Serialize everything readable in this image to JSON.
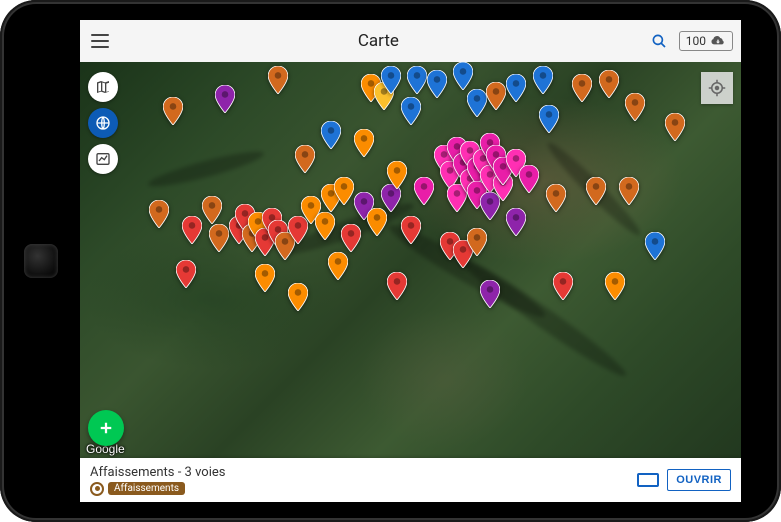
{
  "appbar": {
    "title": "Carte",
    "cloud_count": "100"
  },
  "map": {
    "attribution": "Google"
  },
  "bottom_sheet": {
    "title": "Affaissements - 3 voies",
    "tag_label": "Affaissements",
    "open_label": "OUVRIR"
  },
  "colors": {
    "red": "#e53935",
    "orange": "#fb8c00",
    "darkorange": "#d2691e",
    "magenta": "#e91ea8",
    "pink": "#ff2fb3",
    "purple": "#8e24aa",
    "blue": "#1e73d6",
    "yellow": "#fbc02d"
  },
  "markers": [
    {
      "x": 14,
      "y": 16,
      "c": "darkorange"
    },
    {
      "x": 22,
      "y": 13,
      "c": "purple"
    },
    {
      "x": 30,
      "y": 8,
      "c": "darkorange"
    },
    {
      "x": 34,
      "y": 28,
      "c": "darkorange"
    },
    {
      "x": 38,
      "y": 22,
      "c": "blue"
    },
    {
      "x": 43,
      "y": 24,
      "c": "orange"
    },
    {
      "x": 44,
      "y": 10,
      "c": "orange"
    },
    {
      "x": 46,
      "y": 12,
      "c": "yellow"
    },
    {
      "x": 47,
      "y": 8,
      "c": "blue"
    },
    {
      "x": 50,
      "y": 16,
      "c": "blue"
    },
    {
      "x": 51,
      "y": 8,
      "c": "blue"
    },
    {
      "x": 54,
      "y": 9,
      "c": "blue"
    },
    {
      "x": 58,
      "y": 7,
      "c": "blue"
    },
    {
      "x": 60,
      "y": 14,
      "c": "blue"
    },
    {
      "x": 63,
      "y": 12,
      "c": "darkorange"
    },
    {
      "x": 66,
      "y": 10,
      "c": "blue"
    },
    {
      "x": 70,
      "y": 8,
      "c": "blue"
    },
    {
      "x": 71,
      "y": 18,
      "c": "blue"
    },
    {
      "x": 76,
      "y": 10,
      "c": "darkorange"
    },
    {
      "x": 80,
      "y": 9,
      "c": "darkorange"
    },
    {
      "x": 84,
      "y": 15,
      "c": "darkorange"
    },
    {
      "x": 90,
      "y": 20,
      "c": "darkorange"
    },
    {
      "x": 12,
      "y": 42,
      "c": "darkorange"
    },
    {
      "x": 17,
      "y": 46,
      "c": "red"
    },
    {
      "x": 20,
      "y": 41,
      "c": "darkorange"
    },
    {
      "x": 21,
      "y": 48,
      "c": "darkorange"
    },
    {
      "x": 24,
      "y": 46,
      "c": "red"
    },
    {
      "x": 25,
      "y": 43,
      "c": "red"
    },
    {
      "x": 26,
      "y": 48,
      "c": "darkorange"
    },
    {
      "x": 27,
      "y": 45,
      "c": "orange"
    },
    {
      "x": 28,
      "y": 49,
      "c": "red"
    },
    {
      "x": 29,
      "y": 44,
      "c": "red"
    },
    {
      "x": 30,
      "y": 47,
      "c": "red"
    },
    {
      "x": 31,
      "y": 50,
      "c": "darkorange"
    },
    {
      "x": 33,
      "y": 46,
      "c": "red"
    },
    {
      "x": 35,
      "y": 41,
      "c": "orange"
    },
    {
      "x": 37,
      "y": 45,
      "c": "orange"
    },
    {
      "x": 38,
      "y": 38,
      "c": "orange"
    },
    {
      "x": 40,
      "y": 36,
      "c": "orange"
    },
    {
      "x": 41,
      "y": 48,
      "c": "red"
    },
    {
      "x": 43,
      "y": 40,
      "c": "purple"
    },
    {
      "x": 45,
      "y": 44,
      "c": "orange"
    },
    {
      "x": 47,
      "y": 38,
      "c": "purple"
    },
    {
      "x": 48,
      "y": 32,
      "c": "orange"
    },
    {
      "x": 50,
      "y": 46,
      "c": "red"
    },
    {
      "x": 52,
      "y": 36,
      "c": "magenta"
    },
    {
      "x": 55,
      "y": 28,
      "c": "pink"
    },
    {
      "x": 56,
      "y": 32,
      "c": "pink"
    },
    {
      "x": 57,
      "y": 26,
      "c": "magenta"
    },
    {
      "x": 57,
      "y": 38,
      "c": "pink"
    },
    {
      "x": 58,
      "y": 30,
      "c": "magenta"
    },
    {
      "x": 59,
      "y": 34,
      "c": "pink"
    },
    {
      "x": 59,
      "y": 27,
      "c": "pink"
    },
    {
      "x": 60,
      "y": 31,
      "c": "magenta"
    },
    {
      "x": 60,
      "y": 37,
      "c": "magenta"
    },
    {
      "x": 61,
      "y": 29,
      "c": "pink"
    },
    {
      "x": 62,
      "y": 25,
      "c": "magenta"
    },
    {
      "x": 62,
      "y": 33,
      "c": "pink"
    },
    {
      "x": 62,
      "y": 40,
      "c": "purple"
    },
    {
      "x": 63,
      "y": 28,
      "c": "magenta"
    },
    {
      "x": 64,
      "y": 35,
      "c": "pink"
    },
    {
      "x": 64,
      "y": 31,
      "c": "magenta"
    },
    {
      "x": 66,
      "y": 29,
      "c": "pink"
    },
    {
      "x": 68,
      "y": 33,
      "c": "magenta"
    },
    {
      "x": 66,
      "y": 44,
      "c": "purple"
    },
    {
      "x": 56,
      "y": 50,
      "c": "red"
    },
    {
      "x": 58,
      "y": 52,
      "c": "red"
    },
    {
      "x": 60,
      "y": 49,
      "c": "darkorange"
    },
    {
      "x": 72,
      "y": 38,
      "c": "darkorange"
    },
    {
      "x": 78,
      "y": 36,
      "c": "darkorange"
    },
    {
      "x": 83,
      "y": 36,
      "c": "darkorange"
    },
    {
      "x": 87,
      "y": 50,
      "c": "blue"
    },
    {
      "x": 81,
      "y": 60,
      "c": "orange"
    },
    {
      "x": 73,
      "y": 60,
      "c": "red"
    },
    {
      "x": 62,
      "y": 62,
      "c": "purple"
    },
    {
      "x": 48,
      "y": 60,
      "c": "red"
    },
    {
      "x": 33,
      "y": 63,
      "c": "orange"
    },
    {
      "x": 28,
      "y": 58,
      "c": "orange"
    },
    {
      "x": 16,
      "y": 57,
      "c": "red"
    },
    {
      "x": 39,
      "y": 55,
      "c": "orange"
    }
  ]
}
